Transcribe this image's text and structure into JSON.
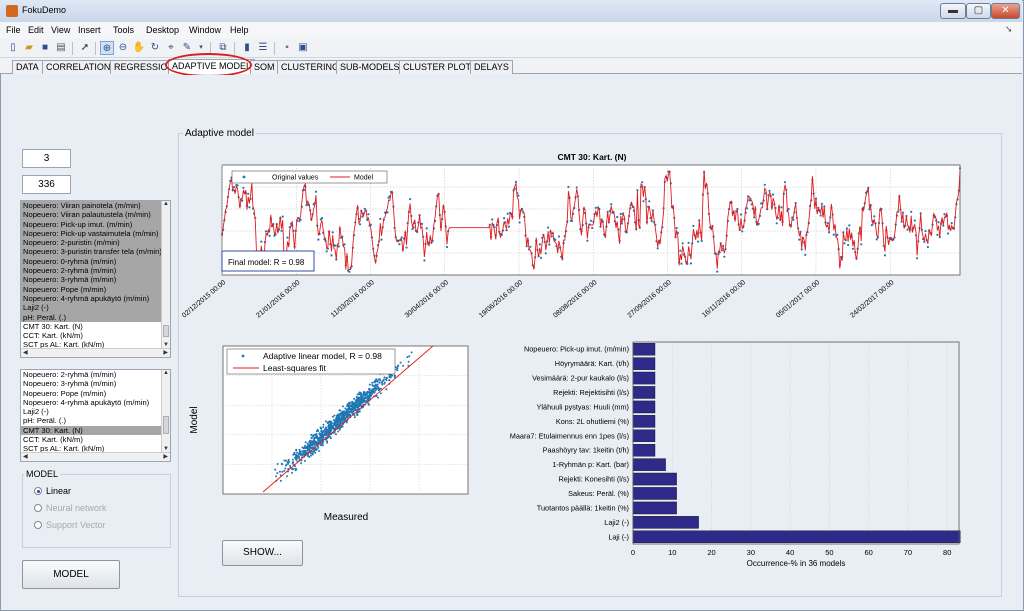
{
  "window": {
    "title": "FokuDemo",
    "controls": {
      "minimize": "▬",
      "maximize": "▢",
      "close": "✕"
    }
  },
  "menubar": [
    "File",
    "Edit",
    "View",
    "Insert",
    "Tools",
    "Desktop",
    "Window",
    "Help"
  ],
  "tabs": [
    {
      "label": "DATA",
      "active": false
    },
    {
      "label": "CORRELATION",
      "active": false
    },
    {
      "label": "REGRESSION",
      "active": false
    },
    {
      "label": "ADAPTIVE MODEL",
      "active": true
    },
    {
      "label": "SOM",
      "active": false
    },
    {
      "label": "CLUSTERING",
      "active": false
    },
    {
      "label": "SUB-MODELS",
      "active": false
    },
    {
      "label": "CLUSTER PLOTS",
      "active": false
    },
    {
      "label": "DELAYS",
      "active": false
    }
  ],
  "panel": {
    "title": "Adaptive model"
  },
  "inputs": {
    "box1": "3",
    "box2": "336"
  },
  "list_top": {
    "items": [
      "Nopeuero: Viiran painotela (m/min)",
      "Nopeuero: Viiran palautustela (m/min)",
      "Nopeuero: Pick-up imut. (m/min)",
      "Nopeuero: Pick-up vastaimutela (m/min)",
      "Nopeuero: 2-puristin (m/min)",
      "Nopeuero: 3-puristin transfer tela (m/min)",
      "Nopeuero: 0-ryhmä (m/min)",
      "Nopeuero: 2-ryhmä (m/min)",
      "Nopeuero: 3-ryhmä (m/min)",
      "Nopeuero: Pope (m/min)",
      "Nopeuero: 4-ryhmä apukäytö (m/min)",
      "Laji2 (-)",
      "pH: Peräl. (.)",
      "CMT 30: Kart. (N)",
      "CCT: Kart. (kN/m)",
      "SCT ps AL: Kart. (kN/m)"
    ],
    "selected_count": 13
  },
  "list_bottom": {
    "items": [
      "Nopeuero: 2-ryhmä (m/min)",
      "Nopeuero: 3-ryhmä (m/min)",
      "Nopeuero: Pope (m/min)",
      "Nopeuero: 4-ryhmä apukäytö (m/min)",
      "Laji2 (-)",
      "pH: Peräl. (.)",
      "CMT 30: Kart. (N)",
      "CCT: Kart. (kN/m)",
      "SCT ps AL: Kart. (kN/m)"
    ],
    "selected_index": 6
  },
  "model": {
    "title": "MODEL",
    "options": [
      {
        "label": "Linear",
        "checked": true,
        "enabled": true
      },
      {
        "label": "Neural network",
        "checked": false,
        "enabled": false
      },
      {
        "label": "Support Vector",
        "checked": false,
        "enabled": false
      }
    ]
  },
  "buttons": {
    "model": "MODEL",
    "show": "SHOW..."
  },
  "colors": {
    "original": "#1f77b4",
    "model": "#e41a1c",
    "bars": "#2e2a8a"
  },
  "chart_data": [
    {
      "type": "line",
      "title": "CMT 30: Kart. (N)",
      "legend": [
        "Original values",
        "Model"
      ],
      "legend_position": "top-left",
      "annotation": "Final model: R = 0.98",
      "x_tick_labels": [
        "02/12/2015 00:00",
        "21/01/2016 00:00",
        "11/03/2016 00:00",
        "30/04/2016 00:00",
        "19/06/2016 00:00",
        "08/08/2016 00:00",
        "27/09/2016 00:00",
        "16/11/2016 00:00",
        "05/01/2017 00:00",
        "24/02/2017 00:00"
      ],
      "grid": true,
      "x_range": [
        "2015-12-02",
        "2017-04-12"
      ],
      "gap": [
        "2016-05-03",
        "2016-05-30"
      ]
    },
    {
      "type": "scatter",
      "legend": [
        "Adaptive linear model, R = 0.98",
        "Least-squares fit"
      ],
      "legend_position": "top",
      "xlabel": "Measured",
      "ylabel": "Model",
      "grid": true
    },
    {
      "type": "bar",
      "orientation": "horizontal",
      "xlabel": "Occurrence-% in 36 models",
      "xlim": [
        0,
        83
      ],
      "x_ticks": [
        0,
        10,
        20,
        30,
        40,
        50,
        60,
        70,
        80
      ],
      "categories": [
        "Nopeuero: Pick-up imut. (m/min)",
        "Höyrymäärä: Kart. (t/h)",
        "Vesimäärä: 2-pur kaukalo (l/s)",
        "Rejekti: Rejektisihti (l/s)",
        "Ylähuuli pystyas: Huuli (mm)",
        "Kons: 2L ohutliemi (%)",
        "Maara7: Etulaimennus enn 1pes (l/s)",
        "Paashöyry tav: 1keitin (t/h)",
        "1-Ryhmän p: Kart. (bar)",
        "Rejekti: Konesihti (l/s)",
        "Sakeus: Peräl. (%)",
        "Tuotantos päällä: 1keitin (%)",
        "Laji2 (-)",
        "Laji (-)"
      ],
      "values": [
        5.6,
        5.6,
        5.6,
        5.6,
        5.6,
        5.6,
        5.6,
        5.6,
        8.3,
        11.1,
        11.1,
        11.1,
        16.7,
        83.3
      ]
    }
  ]
}
